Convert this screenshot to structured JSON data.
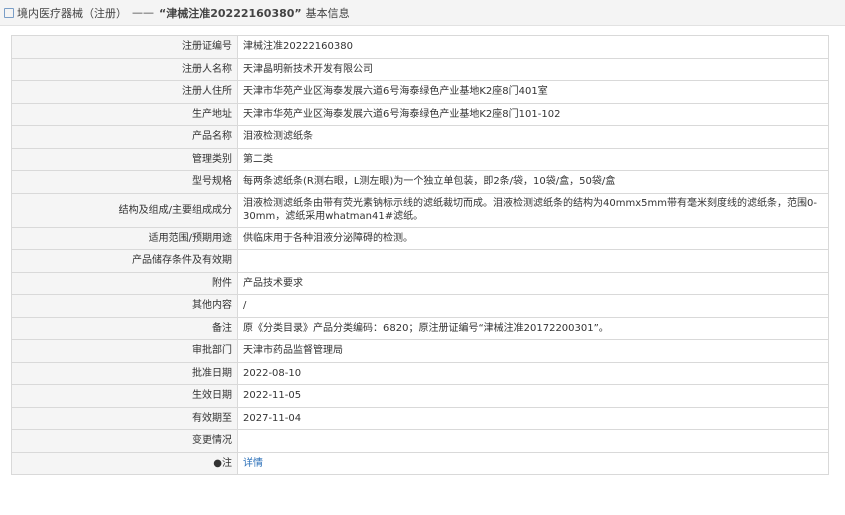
{
  "header": {
    "category": "境内医疗器械（注册）",
    "separator": "——",
    "reg_quote": "“津械注准20222160380”",
    "suffix": "基本信息"
  },
  "rows": [
    {
      "label": "注册证编号",
      "value": "津械注准20222160380"
    },
    {
      "label": "注册人名称",
      "value": "天津晶明新技术开发有限公司"
    },
    {
      "label": "注册人住所",
      "value": "天津市华苑产业区海泰发展六道6号海泰绿色产业基地K2座8门401室"
    },
    {
      "label": "生产地址",
      "value": "天津市华苑产业区海泰发展六道6号海泰绿色产业基地K2座8门101-102"
    },
    {
      "label": "产品名称",
      "value": "泪液检测滤纸条"
    },
    {
      "label": "管理类别",
      "value": "第二类"
    },
    {
      "label": "型号规格",
      "value": "每两条滤纸条(R测右眼，L测左眼)为一个独立单包装，即2条/袋，10袋/盒，50袋/盒"
    },
    {
      "label": "结构及组成/主要组成成分",
      "value": "泪液检测滤纸条由带有荧光素钠标示线的滤纸裁切而成。泪液检测滤纸条的结构为40mmx5mm带有毫米刻度线的滤纸条，范围0-30mm，滤纸采用whatman41#滤纸。"
    },
    {
      "label": "适用范围/预期用途",
      "value": "供临床用于各种泪液分泌障碍的检测。"
    },
    {
      "label": "产品储存条件及有效期",
      "value": ""
    },
    {
      "label": "附件",
      "value": "产品技术要求"
    },
    {
      "label": "其他内容",
      "value": "/"
    },
    {
      "label": "备注",
      "value": "原《分类目录》产品分类编码：6820；原注册证编号“津械注准20172200301”。"
    },
    {
      "label": "审批部门",
      "value": "天津市药品监督管理局"
    },
    {
      "label": "批准日期",
      "value": "2022-08-10"
    },
    {
      "label": "生效日期",
      "value": "2022-11-05"
    },
    {
      "label": "有效期至",
      "value": "2027-11-04"
    },
    {
      "label": "变更情况",
      "value": ""
    }
  ],
  "note_row": {
    "bullet": "●",
    "label": "注",
    "link": "详情"
  }
}
